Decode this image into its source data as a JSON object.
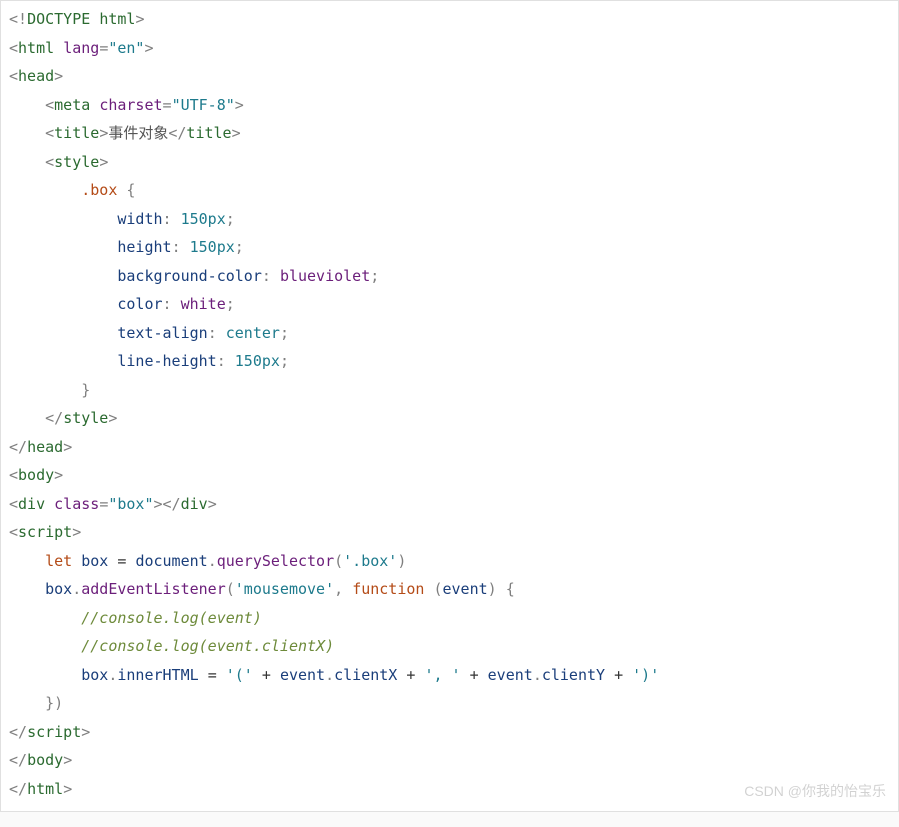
{
  "watermark": "CSDN @你我的怡宝乐",
  "tokens": [
    [
      [
        "p",
        "<!"
      ],
      [
        "tn",
        "DOCTYPE"
      ],
      [
        "p",
        " "
      ],
      [
        "tn",
        "html"
      ],
      [
        "p",
        ">"
      ]
    ],
    [
      [
        "p",
        "<"
      ],
      [
        "tn",
        "html"
      ],
      [
        "p",
        " "
      ],
      [
        "an",
        "lang"
      ],
      [
        "p",
        "="
      ],
      [
        "av",
        "\"en\""
      ],
      [
        "p",
        ">"
      ]
    ],
    [
      [
        "p",
        "<"
      ],
      [
        "tn",
        "head"
      ],
      [
        "p",
        ">"
      ]
    ],
    [
      [
        "p",
        "    <"
      ],
      [
        "tn",
        "meta"
      ],
      [
        "p",
        " "
      ],
      [
        "an",
        "charset"
      ],
      [
        "p",
        "="
      ],
      [
        "av",
        "\"UTF-8\""
      ],
      [
        "p",
        ">"
      ]
    ],
    [
      [
        "p",
        "    <"
      ],
      [
        "tn",
        "title"
      ],
      [
        "p",
        ">"
      ],
      [
        "tx",
        "事件对象"
      ],
      [
        "p",
        "</"
      ],
      [
        "tn",
        "title"
      ],
      [
        "p",
        ">"
      ]
    ],
    [
      [
        "p",
        "    <"
      ],
      [
        "tn",
        "style"
      ],
      [
        "p",
        ">"
      ]
    ],
    [
      [
        "p",
        "        "
      ],
      [
        "kw",
        ".box"
      ],
      [
        "p",
        " {"
      ]
    ],
    [
      [
        "p",
        "            "
      ],
      [
        "id",
        "width"
      ],
      [
        "p",
        ": "
      ],
      [
        "av",
        "150px"
      ],
      [
        "p",
        ";"
      ]
    ],
    [
      [
        "p",
        "            "
      ],
      [
        "id",
        "height"
      ],
      [
        "p",
        ": "
      ],
      [
        "av",
        "150px"
      ],
      [
        "p",
        ";"
      ]
    ],
    [
      [
        "p",
        "            "
      ],
      [
        "id",
        "background-color"
      ],
      [
        "p",
        ": "
      ],
      [
        "fn",
        "blueviolet"
      ],
      [
        "p",
        ";"
      ]
    ],
    [
      [
        "p",
        "            "
      ],
      [
        "id",
        "color"
      ],
      [
        "p",
        ": "
      ],
      [
        "fn",
        "white"
      ],
      [
        "p",
        ";"
      ]
    ],
    [
      [
        "p",
        "            "
      ],
      [
        "id",
        "text-align"
      ],
      [
        "p",
        ": "
      ],
      [
        "av",
        "center"
      ],
      [
        "p",
        ";"
      ]
    ],
    [
      [
        "p",
        "            "
      ],
      [
        "id",
        "line-height"
      ],
      [
        "p",
        ": "
      ],
      [
        "av",
        "150px"
      ],
      [
        "p",
        ";"
      ]
    ],
    [
      [
        "p",
        "        }"
      ]
    ],
    [
      [
        "p",
        "    </"
      ],
      [
        "tn",
        "style"
      ],
      [
        "p",
        ">"
      ]
    ],
    [
      [
        "p",
        "</"
      ],
      [
        "tn",
        "head"
      ],
      [
        "p",
        ">"
      ]
    ],
    [
      [
        "p",
        "<"
      ],
      [
        "tn",
        "body"
      ],
      [
        "p",
        ">"
      ]
    ],
    [
      [
        "p",
        "<"
      ],
      [
        "tn",
        "div"
      ],
      [
        "p",
        " "
      ],
      [
        "an",
        "class"
      ],
      [
        "p",
        "="
      ],
      [
        "av",
        "\"box\""
      ],
      [
        "p",
        "></"
      ],
      [
        "tn",
        "div"
      ],
      [
        "p",
        ">"
      ]
    ],
    [
      [
        "p",
        "<"
      ],
      [
        "tn",
        "script"
      ],
      [
        "p",
        ">"
      ]
    ],
    [
      [
        "p",
        "    "
      ],
      [
        "kw",
        "let"
      ],
      [
        "p",
        " "
      ],
      [
        "id",
        "box"
      ],
      [
        "p",
        " "
      ],
      [
        "op",
        "="
      ],
      [
        "p",
        " "
      ],
      [
        "id",
        "document"
      ],
      [
        "p",
        "."
      ],
      [
        "fn",
        "querySelector"
      ],
      [
        "p",
        "("
      ],
      [
        "av",
        "'.box'"
      ],
      [
        "p",
        ")"
      ]
    ],
    [
      [
        "p",
        "    "
      ],
      [
        "id",
        "box"
      ],
      [
        "p",
        "."
      ],
      [
        "fn",
        "addEventListener"
      ],
      [
        "p",
        "("
      ],
      [
        "av",
        "'mousemove'"
      ],
      [
        "p",
        ", "
      ],
      [
        "kw",
        "function"
      ],
      [
        "p",
        " ("
      ],
      [
        "id",
        "event"
      ],
      [
        "p",
        ") {"
      ]
    ],
    [
      [
        "p",
        "        "
      ],
      [
        "cm",
        "//console.log(event)"
      ]
    ],
    [
      [
        "p",
        "        "
      ],
      [
        "cm",
        "//console.log(event.clientX)"
      ]
    ],
    [
      [
        "p",
        "        "
      ],
      [
        "id",
        "box"
      ],
      [
        "p",
        "."
      ],
      [
        "id",
        "innerHTML"
      ],
      [
        "p",
        " "
      ],
      [
        "op",
        "="
      ],
      [
        "p",
        " "
      ],
      [
        "av",
        "'('"
      ],
      [
        "p",
        " "
      ],
      [
        "op",
        "+"
      ],
      [
        "p",
        " "
      ],
      [
        "id",
        "event"
      ],
      [
        "p",
        "."
      ],
      [
        "id",
        "clientX"
      ],
      [
        "p",
        " "
      ],
      [
        "op",
        "+"
      ],
      [
        "p",
        " "
      ],
      [
        "av",
        "', '"
      ],
      [
        "p",
        " "
      ],
      [
        "op",
        "+"
      ],
      [
        "p",
        " "
      ],
      [
        "id",
        "event"
      ],
      [
        "p",
        "."
      ],
      [
        "id",
        "clientY"
      ],
      [
        "p",
        " "
      ],
      [
        "op",
        "+"
      ],
      [
        "p",
        " "
      ],
      [
        "av",
        "')'"
      ]
    ],
    [
      [
        "p",
        "    })"
      ]
    ],
    [
      [
        "p",
        "</"
      ],
      [
        "tn",
        "script"
      ],
      [
        "p",
        ">"
      ]
    ],
    [
      [
        "p",
        "</"
      ],
      [
        "tn",
        "body"
      ],
      [
        "p",
        ">"
      ]
    ],
    [
      [
        "p",
        "</"
      ],
      [
        "tn",
        "html"
      ],
      [
        "p",
        ">"
      ]
    ]
  ]
}
